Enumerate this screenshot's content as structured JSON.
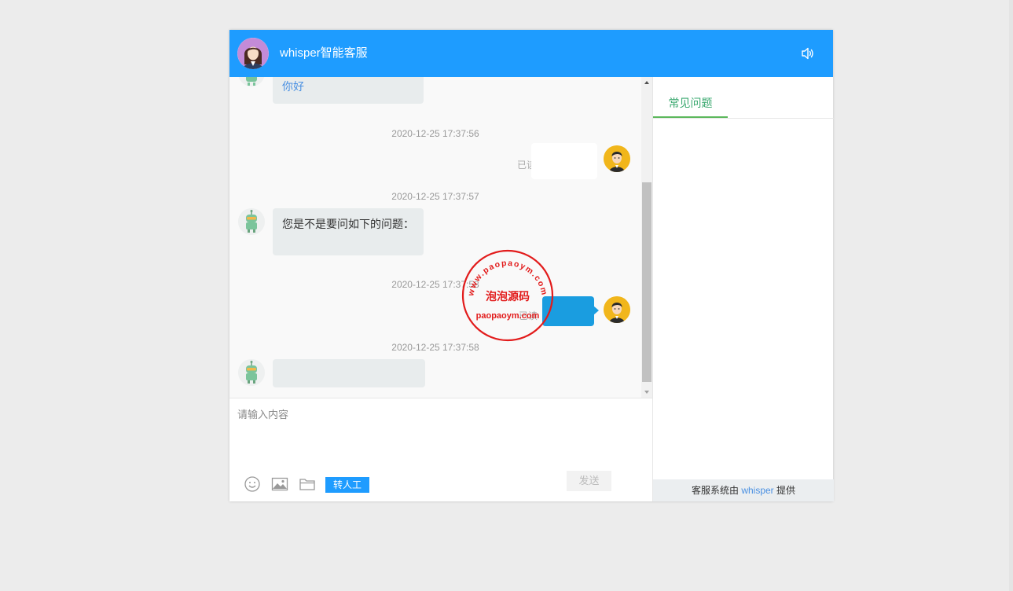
{
  "header": {
    "title": "whisper智能客服",
    "sound_icon": "speaker-icon"
  },
  "chat": {
    "messages": [
      {
        "from": "bot",
        "text": "你好"
      },
      {
        "timestamp": "2020-12-25 17:37:56",
        "from": "user",
        "status": "已读"
      },
      {
        "timestamp": "2020-12-25 17:37:57",
        "from": "bot",
        "text": "您是不是要问如下的问题："
      },
      {
        "timestamp": "2020-12-25 17:37:58",
        "from": "user",
        "status": "已读"
      },
      {
        "timestamp": "2020-12-25 17:37:58",
        "from": "bot"
      }
    ]
  },
  "input": {
    "placeholder": "请输入内容",
    "transfer_label": "转人工",
    "send_label": "发送",
    "tool_icons": [
      "emoji-icon",
      "image-icon",
      "folder-icon"
    ]
  },
  "side": {
    "tab_label": "常见问题",
    "footer_prefix": "客服系统由",
    "footer_brand": "whisper",
    "footer_suffix": "提供"
  },
  "watermark": {
    "url_top": "www.paopaoym.com",
    "name": "泡泡源码",
    "url_bottom": "paopaoym.com"
  },
  "colors": {
    "header": "#1e9cff",
    "user_bubble": "#1a9de0",
    "bot_bubble": "#e8eced",
    "tab_accent": "#5cb85c",
    "stamp": "#e21b1b"
  }
}
